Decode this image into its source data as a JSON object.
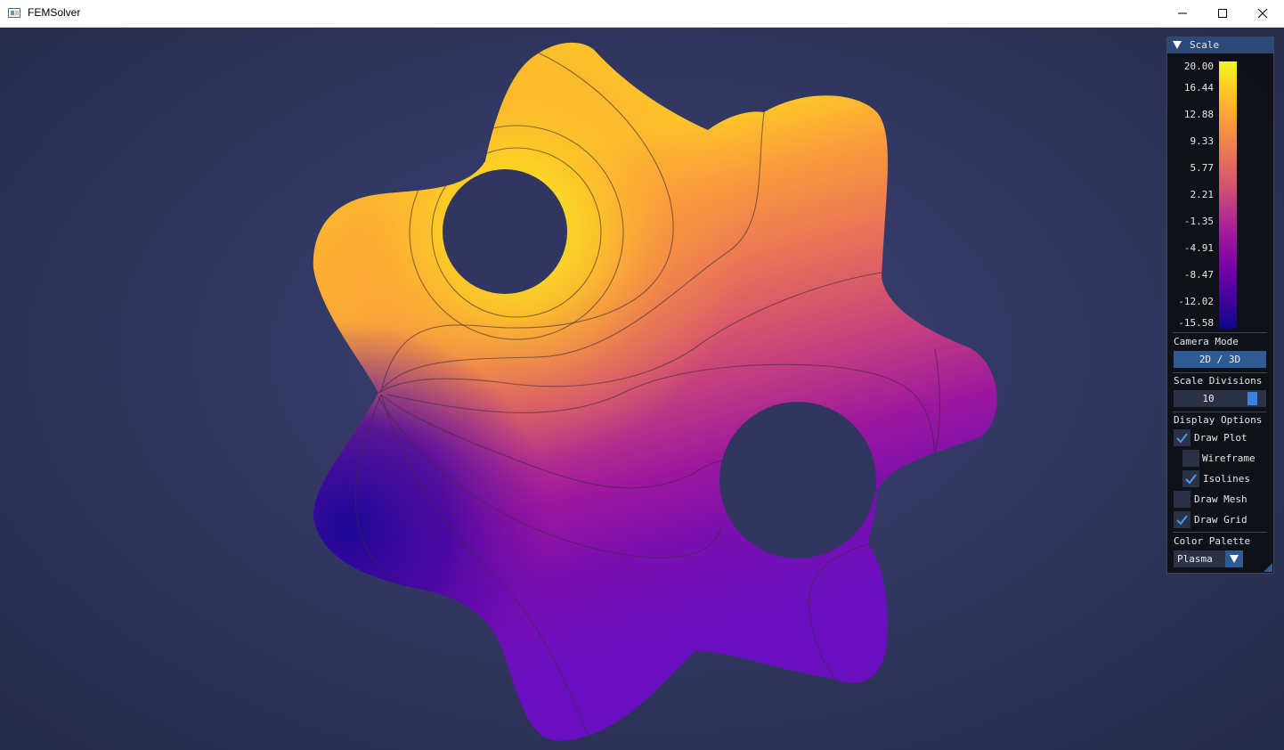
{
  "window": {
    "title": "FEMSolver"
  },
  "panel": {
    "header": "Scale",
    "scale_ticks": [
      "20.00",
      "16.44",
      "12.88",
      "9.33",
      "5.77",
      "2.21",
      "-1.35",
      "-4.91",
      "-8.47",
      "-12.02",
      "-15.58"
    ],
    "camera_mode_label": "Camera Mode",
    "camera_mode_button": "2D / 3D",
    "scale_divisions_label": "Scale Divisions",
    "scale_divisions_value": "10",
    "display_options_label": "Display Options",
    "options": [
      {
        "label": "Draw Plot",
        "checked": true
      },
      {
        "label": "Wireframe",
        "checked": false
      },
      {
        "label": "Isolines",
        "checked": true
      },
      {
        "label": "Draw Mesh",
        "checked": false
      },
      {
        "label": "Draw Grid",
        "checked": true
      }
    ],
    "color_palette_label": "Color Palette",
    "color_palette_value": "Plasma"
  },
  "colors": {
    "accent": "#2f5b92",
    "check": "#4d96f0",
    "background": "#2a2f4e"
  }
}
